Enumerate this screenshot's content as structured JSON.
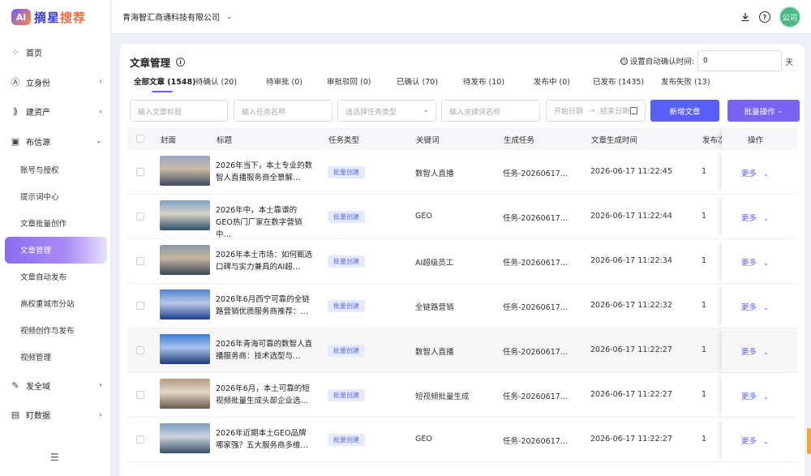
{
  "logo": {
    "mark": "Ai",
    "name_a": "摘星",
    "name_b": "搜荐"
  },
  "sidebar": {
    "items": [
      {
        "label": "首页",
        "icon": "grid-icon",
        "glyph": "⁘",
        "has_children": false
      },
      {
        "label": "立身份",
        "icon": "id-icon",
        "glyph": "Ⓐ",
        "has_children": true
      },
      {
        "label": "建资产",
        "icon": "asset-icon",
        "glyph": "⟫",
        "has_children": true
      },
      {
        "label": "布信源",
        "icon": "source-icon",
        "glyph": "▣",
        "has_children": true,
        "expanded": true
      }
    ],
    "sub_items": [
      {
        "label": "账号与授权",
        "active": false
      },
      {
        "label": "提示词中心",
        "active": false
      },
      {
        "label": "文章批量创作",
        "active": false
      },
      {
        "label": "文章管理",
        "active": true
      },
      {
        "label": "文章自动发布",
        "active": false
      },
      {
        "label": "高权重城市分站",
        "active": false
      },
      {
        "label": "视频创作与发布",
        "active": false
      },
      {
        "label": "视频管理",
        "active": false
      }
    ],
    "bottom_items": [
      {
        "label": "发全域",
        "icon": "send-icon",
        "glyph": "✎",
        "has_children": true
      },
      {
        "label": "盯数据",
        "icon": "data-icon",
        "glyph": "▤",
        "has_children": true
      }
    ],
    "collapse_glyph": "☰"
  },
  "header": {
    "company": "青海智汇商通科技有限公司",
    "avatar_text": "公司"
  },
  "page": {
    "title": "文章管理",
    "auto_confirm_label": "设置自动确认时间:",
    "auto_confirm_value": "0",
    "auto_confirm_unit": "天"
  },
  "tabs": [
    {
      "label": "全部文章 (1548)",
      "active": true
    },
    {
      "label": "待确认 (20)",
      "active": false
    },
    {
      "label": "待审批 (0)",
      "active": false
    },
    {
      "label": "审批驳回 (0)",
      "active": false
    },
    {
      "label": "已确认 (70)",
      "active": false
    },
    {
      "label": "待发布 (10)",
      "active": false
    },
    {
      "label": "发布中 (0)",
      "active": false
    },
    {
      "label": "已发布 (1435)",
      "active": false
    },
    {
      "label": "发布失败 (13)",
      "active": false
    }
  ],
  "filters": {
    "title_placeholder": "输入文章标题",
    "task_placeholder": "输入任务名称",
    "type_placeholder": "请选择任务类型",
    "keyword_placeholder": "输入关键词名称",
    "start_date_placeholder": "开始日期",
    "end_date_placeholder": "结束日期",
    "new_button": "新增文章",
    "batch_button": "批量操作"
  },
  "table": {
    "columns": [
      "封面",
      "标题",
      "任务类型",
      "关键词",
      "生成任务",
      "文章生成时间",
      "发布次",
      "操作"
    ],
    "rows": [
      {
        "title": "2026年当下，本土专业的数智人直播服务商全景解…",
        "type": "批量创建",
        "keyword": "数智人直播",
        "task": "任务-20260617…",
        "time": "2026-06-17 11:22:45",
        "count": "1",
        "op": "更多",
        "thumb": [
          "#3f4a63",
          "#9aa9c4",
          "#c8b9a3"
        ]
      },
      {
        "title": "2026年中，本土靠谱的GEO热门厂家在数字营销中…",
        "type": "批量创建",
        "keyword": "GEO",
        "task": "任务-20260617…",
        "time": "2026-06-17 11:22:44",
        "count": "1",
        "op": "更多",
        "thumb": [
          "#2f4f6f",
          "#7d9ec2",
          "#d7d2c4"
        ]
      },
      {
        "title": "2026年本土市场：如何甄选口碑与实力兼具的AI超…",
        "type": "批量创建",
        "keyword": "AI超级员工",
        "task": "任务-20260617…",
        "time": "2026-06-17 11:22:34",
        "count": "1",
        "op": "更多",
        "thumb": [
          "#3d4652",
          "#8c99ab",
          "#c2b49e"
        ]
      },
      {
        "title": "2026年6月西宁可靠的全链路营销优质服务商推荐：…",
        "type": "批量创建",
        "keyword": "全链路营销",
        "task": "任务-20260617…",
        "time": "2026-06-17 11:22:32",
        "count": "1",
        "op": "更多",
        "thumb": [
          "#1e3f8a",
          "#4f7fd0",
          "#b9c9e8"
        ]
      },
      {
        "title": "2026年青海可靠的数智人直播服务商：技术选型与…",
        "type": "批量创建",
        "keyword": "数智人直播",
        "task": "任务-20260617…",
        "time": "2026-06-17 11:22:27",
        "count": "1",
        "op": "更多",
        "thumb": [
          "#1c3a78",
          "#3f7ad4",
          "#a8c2ec"
        ]
      },
      {
        "title": "2026年6月，本土可靠的短视频批量生成头部企业选…",
        "type": "批量创建",
        "keyword": "短视频批量生成",
        "task": "任务-20260617…",
        "time": "2026-06-17 11:22:27",
        "count": "1",
        "op": "更多",
        "thumb": [
          "#6b5a4a",
          "#b59c82",
          "#e2d6c6"
        ]
      },
      {
        "title": "2026年近期本土GEO品牌哪家强？五大服务商多维…",
        "type": "批量创建",
        "keyword": "GEO",
        "task": "任务-20260617…",
        "time": "2026-06-17 11:22:27",
        "count": "1",
        "op": "更多",
        "thumb": [
          "#3a4f6a",
          "#7f9bbd",
          "#cbd2dc"
        ]
      }
    ]
  },
  "colors": {
    "primary": "#5a5ff6",
    "accent": "#7a63f0",
    "tag_bg": "#e6eaff"
  }
}
